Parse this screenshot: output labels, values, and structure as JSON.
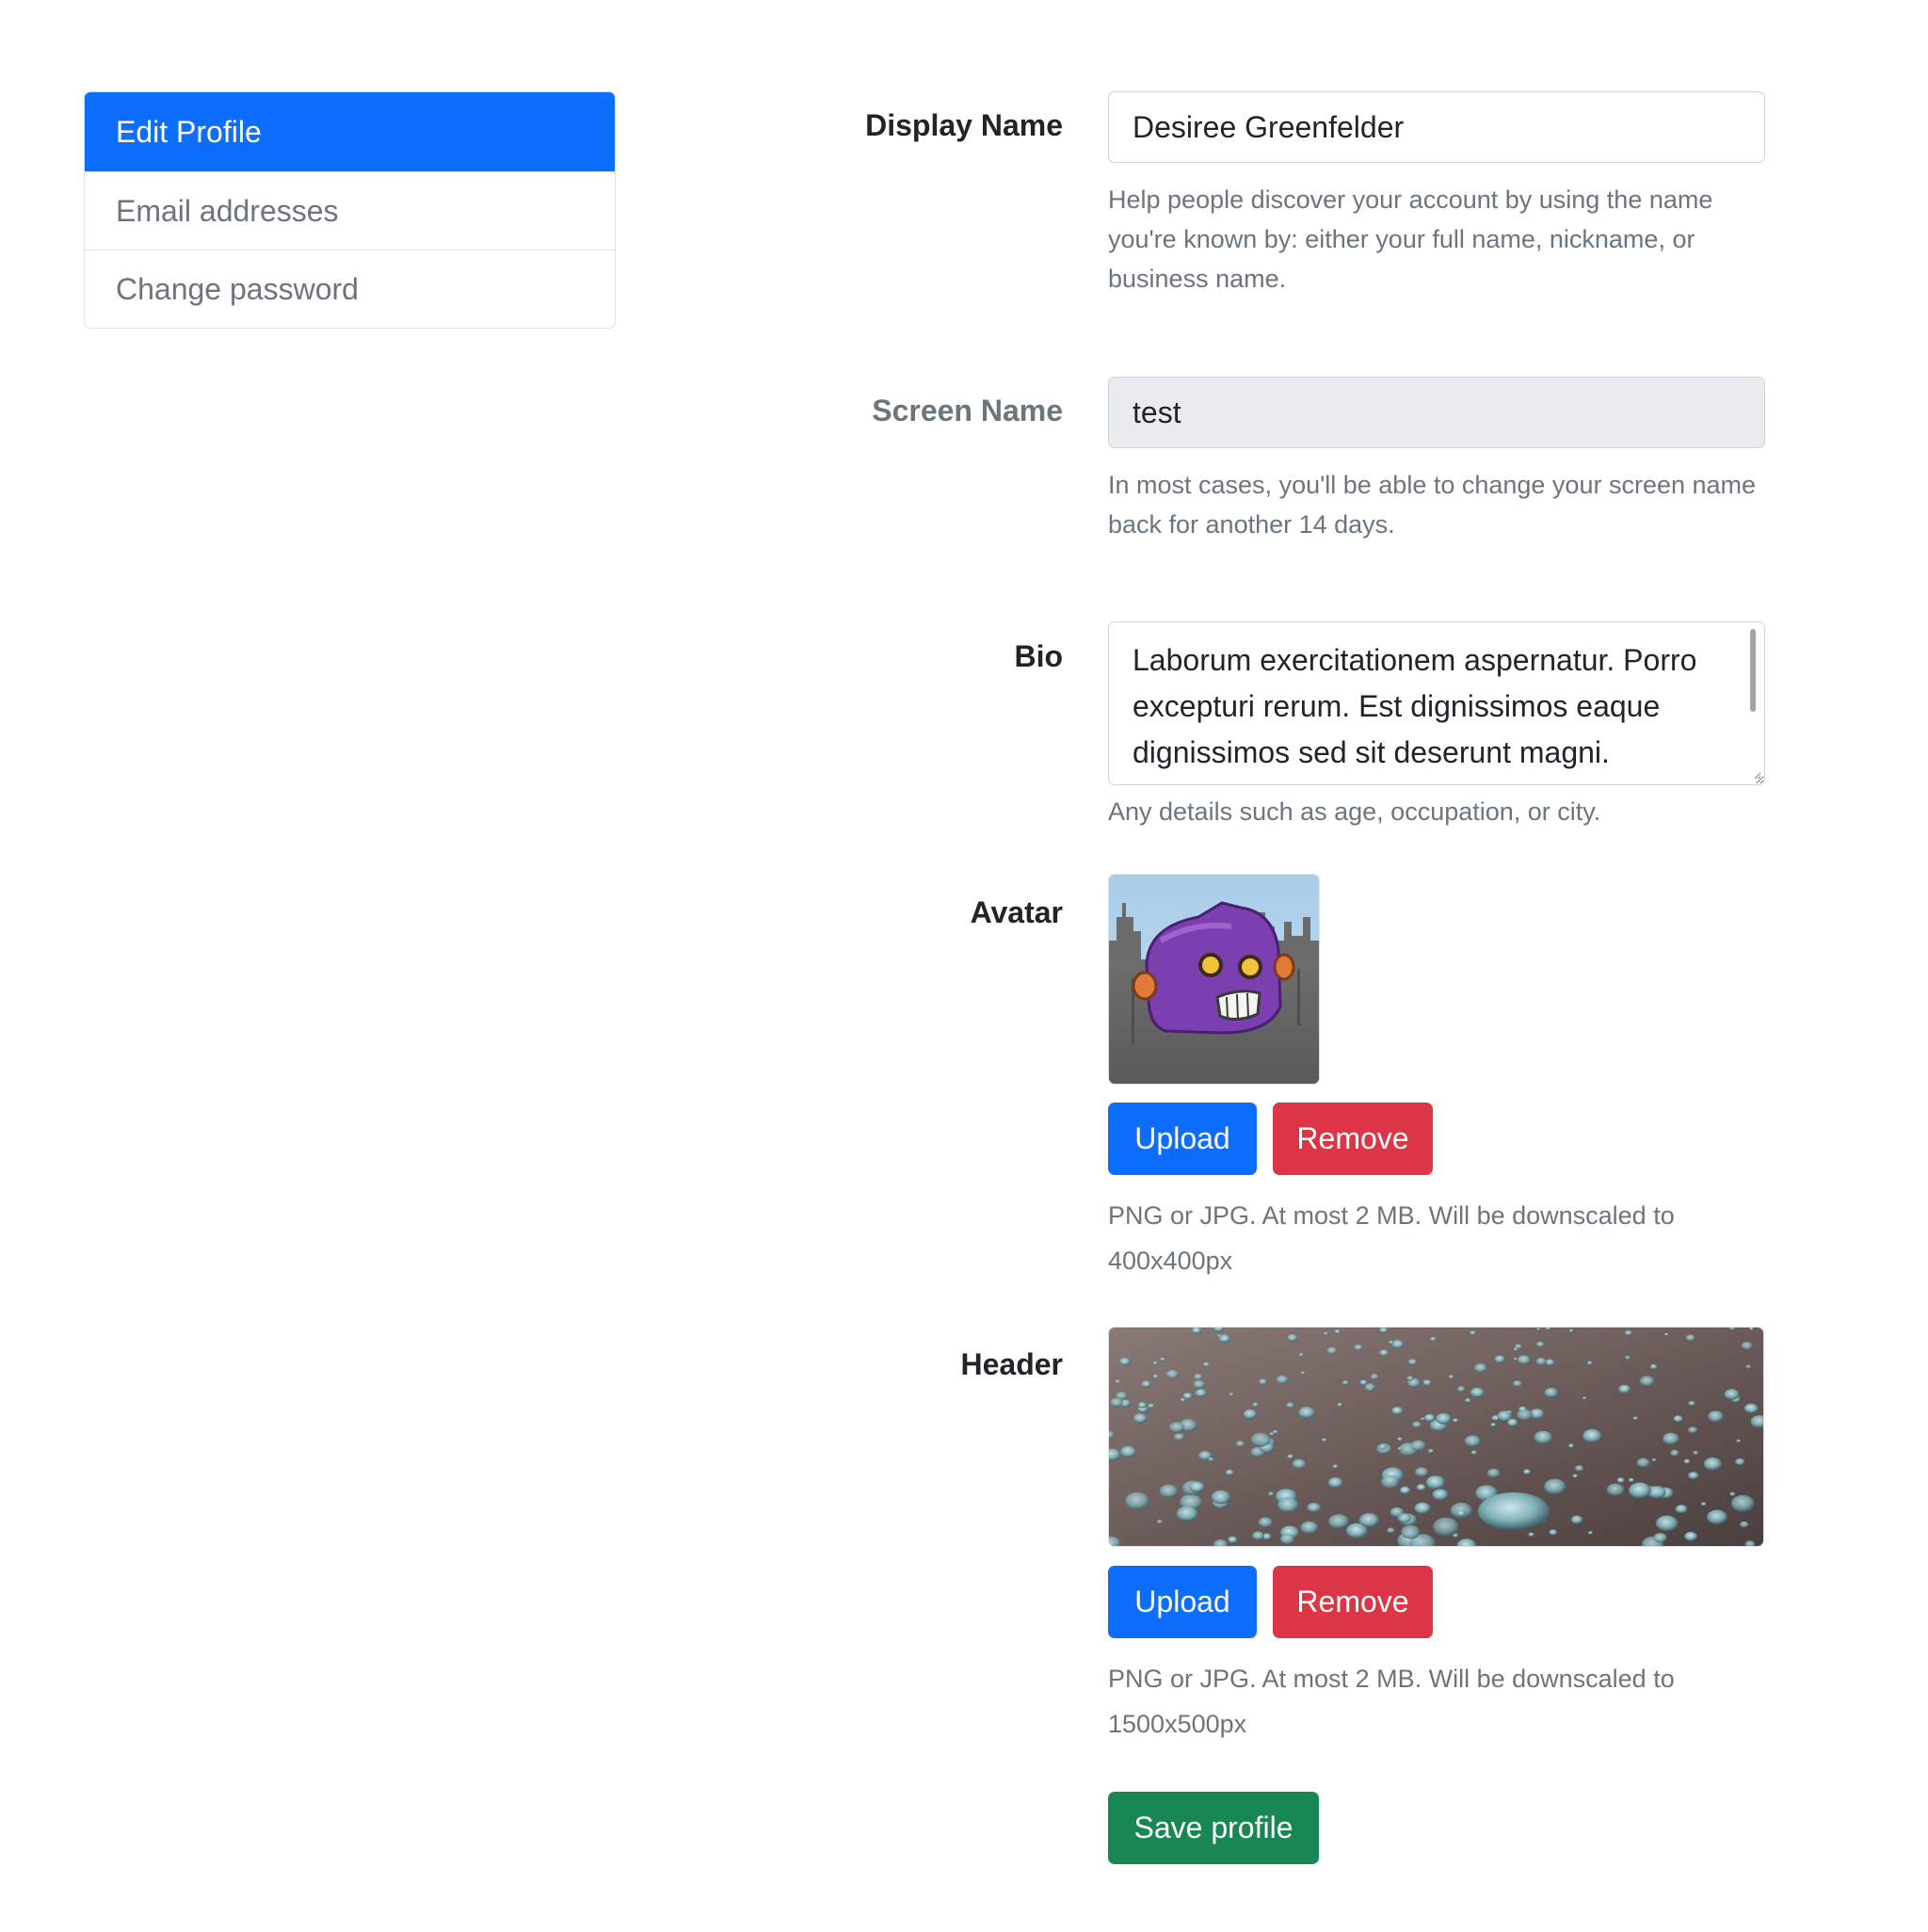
{
  "sidebar": {
    "items": [
      {
        "label": "Edit Profile",
        "active": true
      },
      {
        "label": "Email addresses",
        "active": false
      },
      {
        "label": "Change password",
        "active": false
      }
    ]
  },
  "form": {
    "display_name": {
      "label": "Display Name",
      "value": "Desiree Greenfelder",
      "help": "Help people discover your account by using the name you're known by: either your full name, nickname, or business name."
    },
    "screen_name": {
      "label": "Screen Name",
      "value": "test",
      "help": "In most cases, you'll be able to change your screen name back for another 14 days."
    },
    "bio": {
      "label": "Bio",
      "value": "Laborum exercitationem aspernatur. Porro excepturi rerum. Est dignissimos eaque dignissimos sed sit deserunt magni.",
      "help": "Any details such as age, occupation, or city."
    },
    "avatar": {
      "label": "Avatar",
      "upload_label": "Upload",
      "remove_label": "Remove",
      "help": "PNG or JPG. At most 2 MB. Will be downscaled to 400x400px"
    },
    "header": {
      "label": "Header",
      "upload_label": "Upload",
      "remove_label": "Remove",
      "help": "PNG or JPG. At most 2 MB. Will be downscaled to 1500x500px"
    },
    "save_label": "Save profile"
  },
  "colors": {
    "primary": "#0d6efd",
    "danger": "#dc3545",
    "success": "#198754",
    "muted_text": "#6c757d",
    "readonly_bg": "#e9ecef"
  }
}
